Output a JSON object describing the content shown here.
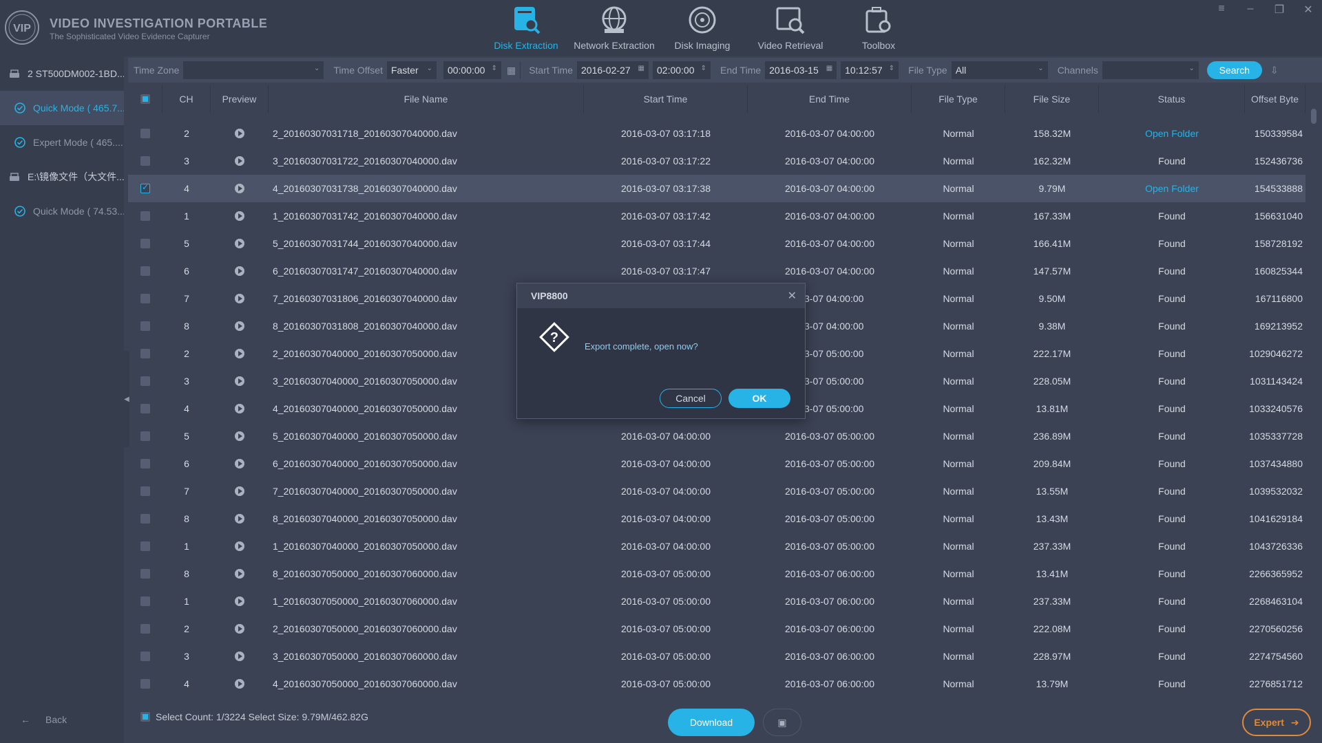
{
  "app": {
    "title": "VIDEO INVESTIGATION PORTABLE",
    "subtitle": "The Sophisticated Video Evidence Capturer",
    "logo_text": "VIP"
  },
  "nav": {
    "items": [
      {
        "label": "Disk Extraction",
        "icon": "disk-extraction-icon",
        "active": true
      },
      {
        "label": "Network Extraction",
        "icon": "network-extraction-icon",
        "active": false
      },
      {
        "label": "Disk Imaging",
        "icon": "disk-imaging-icon",
        "active": false
      },
      {
        "label": "Video Retrieval",
        "icon": "video-retrieval-icon",
        "active": false
      },
      {
        "label": "Toolbox",
        "icon": "toolbox-icon",
        "active": false
      }
    ]
  },
  "window_controls": {
    "menu": "≡",
    "minimize": "–",
    "restore": "❐",
    "close": "✕"
  },
  "sidebar": {
    "items": [
      {
        "label": "2 ST500DM002-1BD...",
        "type": "disk"
      },
      {
        "label": "Quick Mode ( 465.7...",
        "type": "mode",
        "active": true
      },
      {
        "label": "Expert Mode ( 465....",
        "type": "mode"
      },
      {
        "label": "E:\\镜像文件（大文件...",
        "type": "disk"
      },
      {
        "label": "Quick Mode ( 74.53...",
        "type": "mode"
      }
    ],
    "back_label": "Back"
  },
  "filters": {
    "time_zone_label": "Time Zone",
    "time_zone_value": "",
    "time_offset_label": "Time Offset",
    "time_offset_value": "Faster",
    "time_offset_time": "00:00:00",
    "start_time_label": "Start Time",
    "start_date": "2016-02-27",
    "start_time": "02:00:00",
    "end_time_label": "End Time",
    "end_date": "2016-03-15",
    "end_time": "10:12:57",
    "file_type_label": "File Type",
    "file_type_value": "All",
    "channels_label": "Channels",
    "channels_value": "",
    "search_label": "Search"
  },
  "table": {
    "columns": [
      "CH",
      "Preview",
      "File Name",
      "Start Time",
      "End Time",
      "File Type",
      "File Size",
      "Status",
      "Offset Byte"
    ],
    "rows": [
      {
        "ch": "2",
        "name": "2_20160307031718_20160307040000.dav",
        "start": "2016-03-07 03:17:18",
        "end": "2016-03-07 04:00:00",
        "type": "Normal",
        "size": "158.32M",
        "status": "Open Folder",
        "offset": "150339584",
        "checked": false,
        "link": true
      },
      {
        "ch": "3",
        "name": "3_20160307031722_20160307040000.dav",
        "start": "2016-03-07 03:17:22",
        "end": "2016-03-07 04:00:00",
        "type": "Normal",
        "size": "162.32M",
        "status": "Found",
        "offset": "152436736",
        "checked": false,
        "link": false
      },
      {
        "ch": "4",
        "name": "4_20160307031738_20160307040000.dav",
        "start": "2016-03-07 03:17:38",
        "end": "2016-03-07 04:00:00",
        "type": "Normal",
        "size": "9.79M",
        "status": "Open Folder",
        "offset": "154533888",
        "checked": true,
        "link": true
      },
      {
        "ch": "1",
        "name": "1_20160307031742_20160307040000.dav",
        "start": "2016-03-07 03:17:42",
        "end": "2016-03-07 04:00:00",
        "type": "Normal",
        "size": "167.33M",
        "status": "Found",
        "offset": "156631040",
        "checked": false,
        "link": false
      },
      {
        "ch": "5",
        "name": "5_20160307031744_20160307040000.dav",
        "start": "2016-03-07 03:17:44",
        "end": "2016-03-07 04:00:00",
        "type": "Normal",
        "size": "166.41M",
        "status": "Found",
        "offset": "158728192",
        "checked": false,
        "link": false
      },
      {
        "ch": "6",
        "name": "6_20160307031747_20160307040000.dav",
        "start": "2016-03-07 03:17:47",
        "end": "2016-03-07 04:00:00",
        "type": "Normal",
        "size": "147.57M",
        "status": "Found",
        "offset": "160825344",
        "checked": false,
        "link": false
      },
      {
        "ch": "7",
        "name": "7_20160307031806_20160307040000.dav",
        "start": "",
        "end": "-03-07 04:00:00",
        "type": "Normal",
        "size": "9.50M",
        "status": "Found",
        "offset": "167116800",
        "checked": false,
        "link": false
      },
      {
        "ch": "8",
        "name": "8_20160307031808_20160307040000.dav",
        "start": "",
        "end": "-03-07 04:00:00",
        "type": "Normal",
        "size": "9.38M",
        "status": "Found",
        "offset": "169213952",
        "checked": false,
        "link": false
      },
      {
        "ch": "2",
        "name": "2_20160307040000_20160307050000.dav",
        "start": "",
        "end": "-03-07 05:00:00",
        "type": "Normal",
        "size": "222.17M",
        "status": "Found",
        "offset": "1029046272",
        "checked": false,
        "link": false
      },
      {
        "ch": "3",
        "name": "3_20160307040000_20160307050000.dav",
        "start": "",
        "end": "-03-07 05:00:00",
        "type": "Normal",
        "size": "228.05M",
        "status": "Found",
        "offset": "1031143424",
        "checked": false,
        "link": false
      },
      {
        "ch": "4",
        "name": "4_20160307040000_20160307050000.dav",
        "start": "",
        "end": "-03-07 05:00:00",
        "type": "Normal",
        "size": "13.81M",
        "status": "Found",
        "offset": "1033240576",
        "checked": false,
        "link": false
      },
      {
        "ch": "5",
        "name": "5_20160307040000_20160307050000.dav",
        "start": "2016-03-07 04:00:00",
        "end": "2016-03-07 05:00:00",
        "type": "Normal",
        "size": "236.89M",
        "status": "Found",
        "offset": "1035337728",
        "checked": false,
        "link": false
      },
      {
        "ch": "6",
        "name": "6_20160307040000_20160307050000.dav",
        "start": "2016-03-07 04:00:00",
        "end": "2016-03-07 05:00:00",
        "type": "Normal",
        "size": "209.84M",
        "status": "Found",
        "offset": "1037434880",
        "checked": false,
        "link": false
      },
      {
        "ch": "7",
        "name": "7_20160307040000_20160307050000.dav",
        "start": "2016-03-07 04:00:00",
        "end": "2016-03-07 05:00:00",
        "type": "Normal",
        "size": "13.55M",
        "status": "Found",
        "offset": "1039532032",
        "checked": false,
        "link": false
      },
      {
        "ch": "8",
        "name": "8_20160307040000_20160307050000.dav",
        "start": "2016-03-07 04:00:00",
        "end": "2016-03-07 05:00:00",
        "type": "Normal",
        "size": "13.43M",
        "status": "Found",
        "offset": "1041629184",
        "checked": false,
        "link": false
      },
      {
        "ch": "1",
        "name": "1_20160307040000_20160307050000.dav",
        "start": "2016-03-07 04:00:00",
        "end": "2016-03-07 05:00:00",
        "type": "Normal",
        "size": "237.33M",
        "status": "Found",
        "offset": "1043726336",
        "checked": false,
        "link": false
      },
      {
        "ch": "8",
        "name": "8_20160307050000_20160307060000.dav",
        "start": "2016-03-07 05:00:00",
        "end": "2016-03-07 06:00:00",
        "type": "Normal",
        "size": "13.41M",
        "status": "Found",
        "offset": "2266365952",
        "checked": false,
        "link": false
      },
      {
        "ch": "1",
        "name": "1_20160307050000_20160307060000.dav",
        "start": "2016-03-07 05:00:00",
        "end": "2016-03-07 06:00:00",
        "type": "Normal",
        "size": "237.33M",
        "status": "Found",
        "offset": "2268463104",
        "checked": false,
        "link": false
      },
      {
        "ch": "2",
        "name": "2_20160307050000_20160307060000.dav",
        "start": "2016-03-07 05:00:00",
        "end": "2016-03-07 06:00:00",
        "type": "Normal",
        "size": "222.08M",
        "status": "Found",
        "offset": "2270560256",
        "checked": false,
        "link": false
      },
      {
        "ch": "3",
        "name": "3_20160307050000_20160307060000.dav",
        "start": "2016-03-07 05:00:00",
        "end": "2016-03-07 06:00:00",
        "type": "Normal",
        "size": "228.97M",
        "status": "Found",
        "offset": "2274754560",
        "checked": false,
        "link": false
      },
      {
        "ch": "4",
        "name": "4_20160307050000_20160307060000.dav",
        "start": "2016-03-07 05:00:00",
        "end": "2016-03-07 06:00:00",
        "type": "Normal",
        "size": "13.79M",
        "status": "Found",
        "offset": "2276851712",
        "checked": false,
        "link": false
      }
    ]
  },
  "bottom": {
    "select_count": "Select Count: 1/3224 Select Size: 9.79M/462.82G",
    "download_label": "Download",
    "expert_label": "Expert"
  },
  "dialog": {
    "title": "VIP8800",
    "message": "Export complete, open now?",
    "cancel_label": "Cancel",
    "ok_label": "OK"
  },
  "colors": {
    "accent": "#27b3e6",
    "expert": "#e08a3c",
    "background": "#3b4254"
  }
}
